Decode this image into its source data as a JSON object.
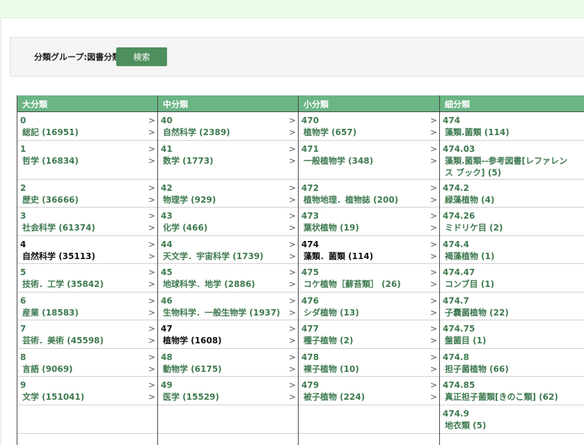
{
  "search": {
    "group_label": "分類グループ:図書分類",
    "button_label": "検索"
  },
  "columns": [
    {
      "header": "大分類",
      "cells": [
        {
          "code": "0",
          "name": "総記 (16951)"
        },
        {
          "code": "1",
          "name": "哲学 (16834)"
        },
        {
          "code": "2",
          "name": "歴史 (36666)"
        },
        {
          "code": "3",
          "name": "社会科学 (61374)"
        },
        {
          "code": "4",
          "name": "自然科学 (35113)",
          "selected": true
        },
        {
          "code": "5",
          "name": "技術．工学 (35842)"
        },
        {
          "code": "6",
          "name": "産業 (18583)"
        },
        {
          "code": "7",
          "name": "芸術．美術 (45598)"
        },
        {
          "code": "8",
          "name": "言語 (9069)"
        },
        {
          "code": "9",
          "name": "文学 (151041)"
        }
      ]
    },
    {
      "header": "中分類",
      "cells": [
        {
          "code": "40",
          "name": "自然科学 (2389)"
        },
        {
          "code": "41",
          "name": "数学 (1773)"
        },
        {
          "code": "42",
          "name": "物理学 (929)"
        },
        {
          "code": "43",
          "name": "化学 (466)"
        },
        {
          "code": "44",
          "name": "天文学．宇宙科学 (1739)"
        },
        {
          "code": "45",
          "name": "地球科学．地学 (2886)"
        },
        {
          "code": "46",
          "name": "生物科学．一般生物学 (1937)"
        },
        {
          "code": "47",
          "name": "植物学 (1608)",
          "selected": true
        },
        {
          "code": "48",
          "name": "動物学 (6175)"
        },
        {
          "code": "49",
          "name": "医学 (15529)"
        }
      ]
    },
    {
      "header": "小分類",
      "cells": [
        {
          "code": "470",
          "name": "植物学 (657)"
        },
        {
          "code": "471",
          "name": "一般植物学 (348)"
        },
        {
          "code": "472",
          "name": "植物地理．植物誌 (200)"
        },
        {
          "code": "473",
          "name": "葉状植物 (19)"
        },
        {
          "code": "474",
          "name": "藻類．菌類 (114)",
          "selected": true
        },
        {
          "code": "475",
          "name": "コケ植物［蘚苔類］ (26)"
        },
        {
          "code": "476",
          "name": "シダ植物 (13)"
        },
        {
          "code": "477",
          "name": "種子植物 (2)"
        },
        {
          "code": "478",
          "name": "裸子植物 (10)"
        },
        {
          "code": "479",
          "name": "被子植物 (224)"
        }
      ]
    },
    {
      "header": "細分類",
      "cells": [
        {
          "code": "474",
          "name": "藻類.菌類 (114)"
        },
        {
          "code": "474.03",
          "name": "藻類.菌類--参考図書[レファレンス ブック] (5)"
        },
        {
          "code": "474.2",
          "name": "緑藻植物 (4)"
        },
        {
          "code": "474.26",
          "name": "ミドリケ目 (2)"
        },
        {
          "code": "474.4",
          "name": "褐藻植物 (1)"
        },
        {
          "code": "474.47",
          "name": "コンブ目 (1)"
        },
        {
          "code": "474.7",
          "name": "子嚢菌植物 (22)"
        },
        {
          "code": "474.75",
          "name": "盤菌目 (1)"
        },
        {
          "code": "474.8",
          "name": "担子菌植物 (66)"
        },
        {
          "code": "474.85",
          "name": "真正担子菌類[きのこ類] (62)"
        },
        {
          "code": "474.9",
          "name": "地衣類 (5)"
        }
      ]
    }
  ],
  "arrow_glyph": ">"
}
